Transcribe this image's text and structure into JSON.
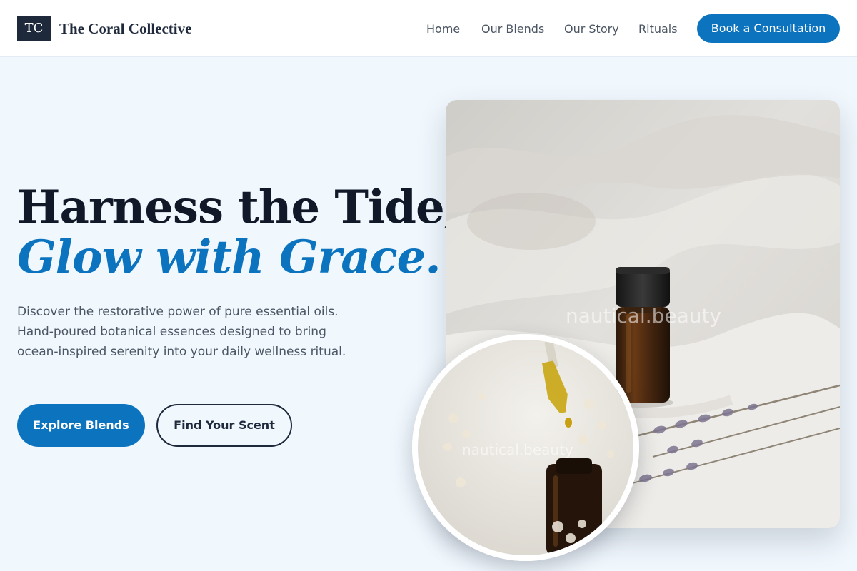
{
  "header": {
    "logo_text": "TC",
    "brand": "The Coral Collective",
    "nav": [
      "Home",
      "Our Blends",
      "Our Story",
      "Rituals"
    ],
    "cta_label": "Book a Consultation"
  },
  "hero": {
    "headline_line1": "Harness the Tide,",
    "headline_line2": "Glow with Grace.",
    "description": "Discover the restorative power of pure essential oils. Hand-poured botanical essences designed to bring ocean-inspired serenity into your daily wellness ritual.",
    "primary_button": "Explore Blends",
    "secondary_button": "Find Your Scent"
  },
  "images": {
    "main_watermark": "nautical.beauty",
    "inset_watermark": "nautical.beauty"
  },
  "colors": {
    "accent": "#0c74bf",
    "dark": "#1e293b",
    "background": "#f0f7fd"
  }
}
